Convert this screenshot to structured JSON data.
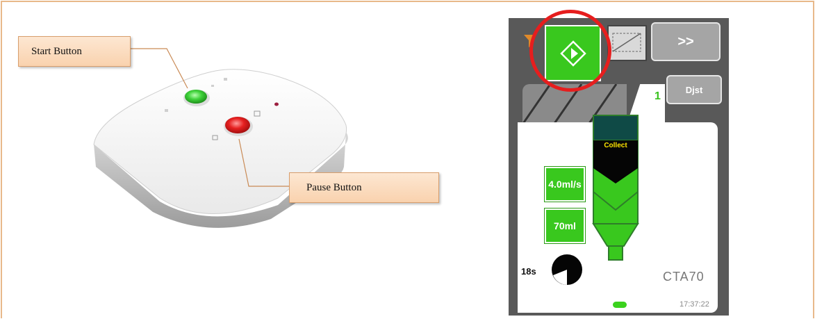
{
  "callouts": {
    "start": "Start Button",
    "pause": "Pause Button"
  },
  "screen": {
    "next_label": ">>",
    "adjust_label": "Djst",
    "tab_number": "1",
    "collect_label": "Collect",
    "flow_rate": "4.0ml/s",
    "volume": "70ml",
    "timer": "18s",
    "model": "CTA70",
    "clock": "17:37:22"
  },
  "colors": {
    "start": "#39c81e",
    "pause": "#e02020",
    "highlight": "#e61e1e",
    "callout_border": "#d89e6c"
  },
  "icons": {
    "play": "play-diamond-icon",
    "stop": "stop-icon",
    "filter": "filter-icon",
    "timer": "timer-pie-icon"
  }
}
